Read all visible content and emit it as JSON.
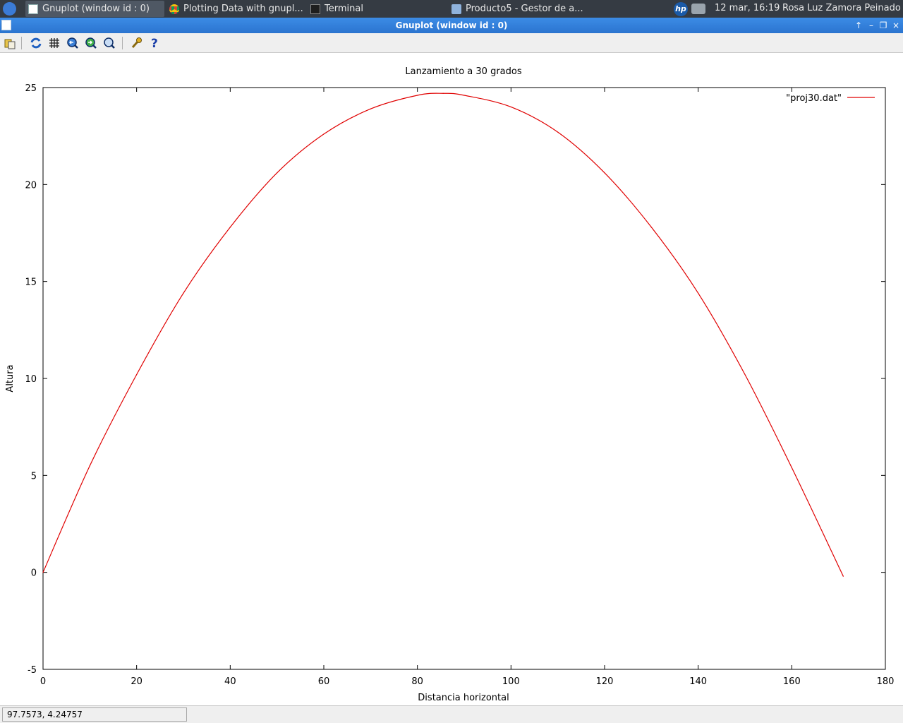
{
  "taskbar": {
    "tasks": [
      {
        "label": "Gnuplot (window id : 0)",
        "icon": "gnuplot-icon",
        "active": true
      },
      {
        "label": "Plotting Data with gnupl...",
        "icon": "chrome-icon",
        "active": false
      },
      {
        "label": "Terminal",
        "icon": "terminal-icon",
        "active": false
      },
      {
        "label": "Producto5 - Gestor de a...",
        "icon": "folder-icon",
        "active": false
      }
    ],
    "clock": "12 mar, 16:19",
    "user": "Rosa Luz Zamora Peinado"
  },
  "window": {
    "title": "Gnuplot (window id : 0)"
  },
  "toolbar": {
    "buttons": [
      "copy-icon",
      "replot-icon",
      "grid-icon",
      "zoom-previous-icon",
      "zoom-next-icon",
      "autoscale-icon",
      "options-icon",
      "help-icon"
    ]
  },
  "status": {
    "coords": "97.7573,  4.24757"
  },
  "colors": {
    "series": "#e00000",
    "titlebar": "#2f7dd9",
    "panel": "#353b43"
  },
  "chart_data": {
    "type": "line",
    "title": "Lanzamiento a 30 grados",
    "xlabel": "Distancia horizontal",
    "ylabel": "Altura",
    "xlim": [
      0,
      180
    ],
    "ylim": [
      -5,
      25
    ],
    "xticks": [
      0,
      20,
      40,
      60,
      80,
      100,
      120,
      140,
      160,
      180
    ],
    "yticks": [
      -5,
      0,
      5,
      10,
      15,
      20,
      25
    ],
    "grid": false,
    "legend_position": "top-right",
    "series": [
      {
        "name": "\"proj30.dat\"",
        "x": [
          0,
          10,
          20,
          30,
          40,
          50,
          60,
          70,
          80,
          85.5,
          90,
          100,
          110,
          120,
          130,
          140,
          150,
          160,
          171
        ],
        "y": [
          0,
          5.5,
          10.2,
          14.4,
          17.8,
          20.6,
          22.6,
          23.9,
          24.6,
          24.7,
          24.6,
          24.0,
          22.7,
          20.6,
          17.8,
          14.4,
          10.2,
          5.4,
          -0.2
        ]
      }
    ]
  }
}
